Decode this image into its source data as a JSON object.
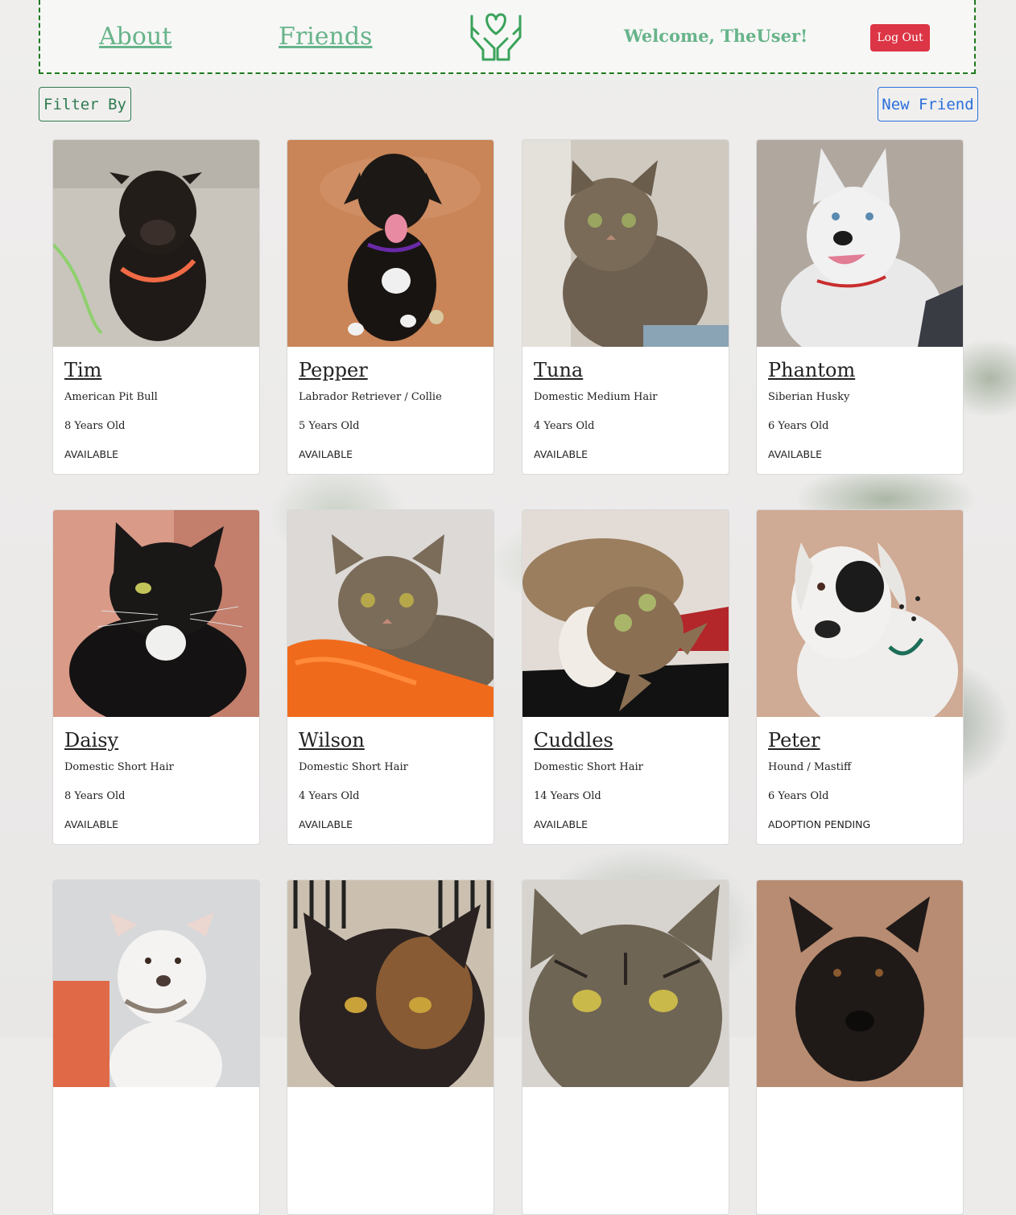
{
  "nav": {
    "about": "About",
    "friends": "Friends",
    "welcome": "Welcome, TheUser!",
    "logout": "Log Out"
  },
  "toolbar": {
    "filter": "Filter By",
    "new_friend": "New Friend"
  },
  "colors": {
    "nav_green": "#67b48a",
    "border_green": "#1e7a1e",
    "logout_red": "#dc3545",
    "primary_blue": "#2a6fdb"
  },
  "pets": [
    {
      "name": "Tim",
      "breed": "American Pit Bull",
      "age": "8 Years Old",
      "status": "AVAILABLE",
      "photo": "dog-black"
    },
    {
      "name": "Pepper",
      "breed": "Labrador Retriever / Collie",
      "age": "5 Years Old",
      "status": "AVAILABLE",
      "photo": "dog-black-on-dirt"
    },
    {
      "name": "Tuna",
      "breed": "Domestic Medium Hair",
      "age": "4 Years Old",
      "status": "AVAILABLE",
      "photo": "cat-tabby"
    },
    {
      "name": "Phantom",
      "breed": "Siberian Husky",
      "age": "6 Years Old",
      "status": "AVAILABLE",
      "photo": "dog-husky"
    },
    {
      "name": "Daisy",
      "breed": "Domestic Short Hair",
      "age": "8 Years Old",
      "status": "AVAILABLE",
      "photo": "cat-black"
    },
    {
      "name": "Wilson",
      "breed": "Domestic Short Hair",
      "age": "4 Years Old",
      "status": "AVAILABLE",
      "photo": "cat-tabby-orange-blanket"
    },
    {
      "name": "Cuddles",
      "breed": "Domestic Short Hair",
      "age": "14 Years Old",
      "status": "AVAILABLE",
      "photo": "cat-tabby-white"
    },
    {
      "name": "Peter",
      "breed": "Hound / Mastiff",
      "age": "6 Years Old",
      "status": "ADOPTION PENDING",
      "photo": "dog-spotted"
    },
    {
      "name": "",
      "breed": "",
      "age": "",
      "status": "",
      "photo": "dog-white"
    },
    {
      "name": "",
      "breed": "",
      "age": "",
      "status": "",
      "photo": "cat-tortie"
    },
    {
      "name": "",
      "breed": "",
      "age": "",
      "status": "",
      "photo": "cat-tabby-closeup"
    },
    {
      "name": "",
      "breed": "",
      "age": "",
      "status": "",
      "photo": "dog-black-closeup"
    }
  ]
}
